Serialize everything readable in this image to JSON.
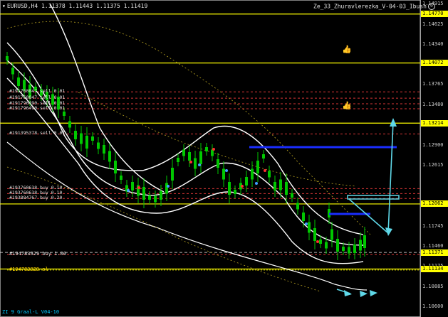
{
  "header": {
    "symbol_info": "EURUSD,H4  1.11378 1.11443 1.11375 1.11419",
    "expert_name": "Ze_33_Zhuravlerezka_V-04-03_Ibush"
  },
  "footer": {
    "text": "ZI 9 Graal-L V04-10"
  },
  "colors": {
    "background": "#000000",
    "candles": "#00c800",
    "bands": "#ffffff",
    "levels": "#ffff00",
    "orders": "#ff4040",
    "blue_lines": "#1a2eff",
    "cyan_arrows": "#5fd8e8"
  },
  "price_axis": {
    "min": 1.1045,
    "max": 1.1497,
    "ticks": [
      "1.14915",
      "1.14625",
      "1.14340",
      "1.13765",
      "1.13480",
      "1.12900",
      "1.12615",
      "1.11745",
      "1.11460",
      "1.11175",
      "1.10885",
      "1.10600"
    ],
    "tick_values": [
      1.14915,
      1.14625,
      1.1434,
      1.13765,
      1.1348,
      1.129,
      1.12615,
      1.11745,
      1.1146,
      1.11175,
      1.10885,
      1.106
    ],
    "level_labels": [
      "1.14770",
      "1.14072",
      "1.13214",
      "1.12062",
      "1.11134"
    ],
    "level_values": [
      1.1477,
      1.14072,
      1.13214,
      1.12062,
      1.11134
    ],
    "current_label": "1.11371",
    "current_value": 1.11371
  },
  "orders": [
    {
      "label": "#191760847 sell 0.01",
      "price": 1.1366
    },
    {
      "label": "#191760847 sell 0.01",
      "price": 1.1357
    },
    {
      "label": "#191796490 sell 0.01",
      "price": 1.1349
    },
    {
      "label": "#191796490 sell 0.01",
      "price": 1.1342
    },
    {
      "label": "#191395378 sell 0.01",
      "price": 1.1306
    },
    {
      "label": "#193760638 buy 0.10",
      "price": 1.1228
    },
    {
      "label": "#193760638 buy 0.10",
      "price": 1.1221
    },
    {
      "label": "#193884767 buy 0.20",
      "price": 1.1214
    },
    {
      "label": "#194783929 buy 1.00",
      "price": 1.1134
    },
    {
      "label": "#194783929 sl",
      "price": 1.1112
    }
  ],
  "thumbs": [
    "👍",
    "👍"
  ]
}
